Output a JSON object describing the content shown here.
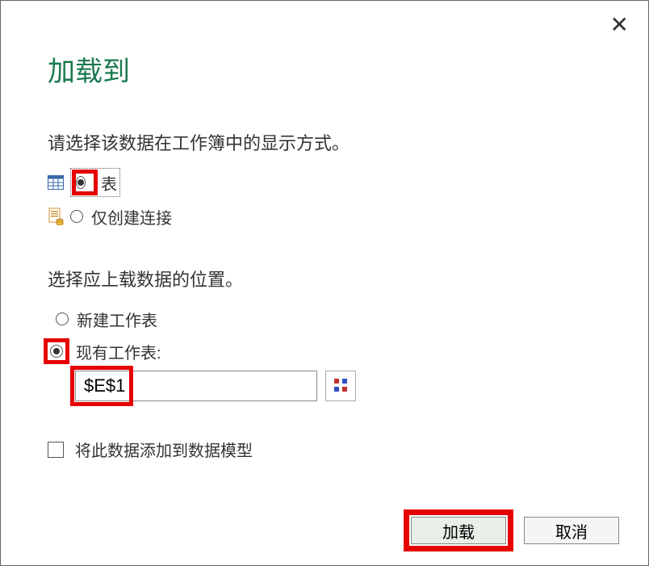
{
  "dialog": {
    "title": "加载到",
    "section1_label": "请选择该数据在工作簿中的显示方式。",
    "option_table": "表",
    "option_connection": "仅创建连接",
    "section2_label": "选择应上载数据的位置。",
    "option_new_sheet": "新建工作表",
    "option_existing_sheet": "现有工作表:",
    "cell_reference": "$E$1",
    "checkbox_datamodel": "将此数据添加到数据模型",
    "button_load": "加载",
    "button_cancel": "取消"
  }
}
